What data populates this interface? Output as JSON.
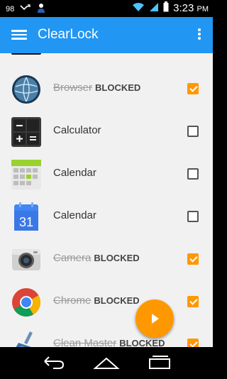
{
  "status": {
    "battery_pct": "98",
    "time": "3:23",
    "ampm": "PM"
  },
  "appbar": {
    "title": "ClearLock"
  },
  "apps": [
    {
      "name": "",
      "blocked": false,
      "checked": false,
      "icon": "mei-app-icon"
    },
    {
      "name": "Browser",
      "blocked": true,
      "blocked_label": "BLOCKED",
      "checked": true,
      "icon": "globe-icon"
    },
    {
      "name": "Calculator",
      "blocked": false,
      "checked": false,
      "icon": "calculator-icon"
    },
    {
      "name": "Calendar",
      "blocked": false,
      "checked": false,
      "icon": "calendar-grid-icon"
    },
    {
      "name": "Calendar",
      "blocked": false,
      "checked": false,
      "icon": "calendar-31-icon",
      "date": "31"
    },
    {
      "name": "Camera",
      "blocked": true,
      "blocked_label": "BLOCKED",
      "checked": true,
      "icon": "camera-icon"
    },
    {
      "name": "Chrome",
      "blocked": true,
      "blocked_label": "BLOCKED",
      "checked": true,
      "icon": "chrome-icon"
    },
    {
      "name": "Clean Master",
      "blocked": true,
      "blocked_label": "BLOCKED",
      "checked": true,
      "icon": "broom-icon"
    }
  ],
  "colors": {
    "primary": "#2196F3",
    "accent": "#FF9800"
  }
}
